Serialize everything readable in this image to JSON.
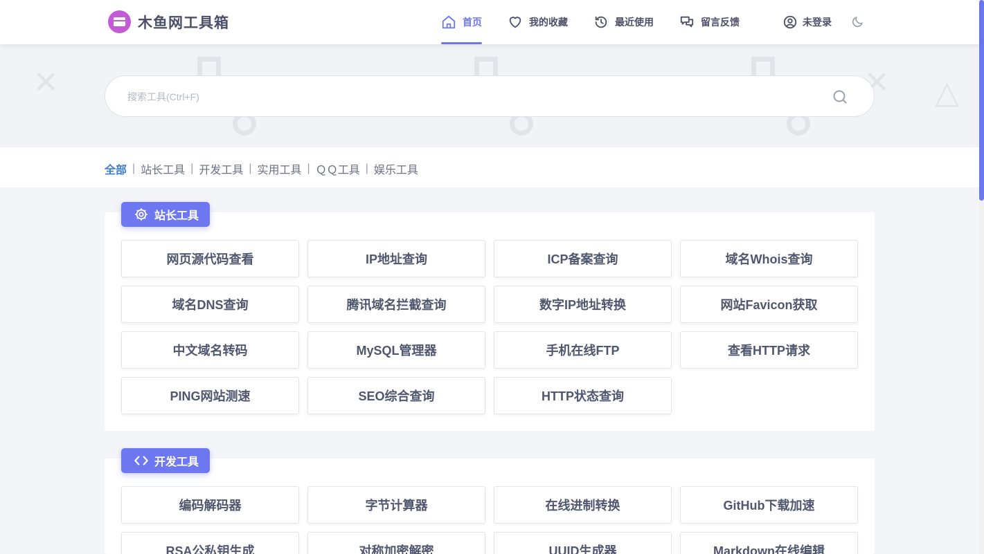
{
  "app": {
    "title": "木鱼网工具箱"
  },
  "nav": {
    "home": "首页",
    "favorites": "我的收藏",
    "recent": "最近使用",
    "feedback": "留言反馈",
    "login": "未登录"
  },
  "search": {
    "placeholder": "搜索工具(Ctrl+F)",
    "value": ""
  },
  "categories": {
    "all": "全部",
    "separator": "|",
    "webmaster": "站长工具",
    "dev": "开发工具",
    "utility": "实用工具",
    "qq": "ＱＱ工具",
    "fun": "娱乐工具"
  },
  "sections": {
    "webmaster": {
      "title": "站长工具",
      "tools": [
        "网页源代码查看",
        "IP地址查询",
        "ICP备案查询",
        "域名Whois查询",
        "域名DNS查询",
        "腾讯域名拦截查询",
        "数字IP地址转换",
        "网站Favicon获取",
        "中文域名转码",
        "MySQL管理器",
        "手机在线FTP",
        "查看HTTP请求",
        "PING网站测速",
        "SEO综合查询",
        "HTTP状态查询"
      ]
    },
    "dev": {
      "title": "开发工具",
      "tools": [
        "编码解码器",
        "字节计算器",
        "在线进制转换",
        "GitHub下载加速",
        "RSA公私钥生成",
        "对称加密解密",
        "UUID生成器",
        "Markdown在线编辑"
      ]
    }
  },
  "colors": {
    "accent": "#6d78f0",
    "link": "#3b7bd8",
    "logo": "#c25bd6"
  },
  "icons": {
    "logo": "toolbox-icon",
    "home": "home-icon",
    "favorites": "heart-icon",
    "recent": "history-icon",
    "feedback": "chat-icon",
    "login": "user-icon",
    "theme": "moon-icon",
    "search": "search-icon",
    "webmaster": "gear-icon",
    "dev": "code-icon"
  }
}
